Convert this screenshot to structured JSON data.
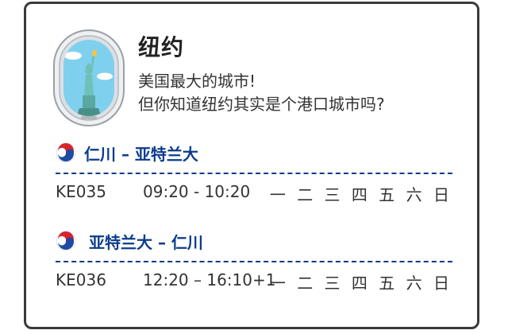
{
  "city": {
    "title": "纽约",
    "desc_line1": "美国最大的城市!",
    "desc_line2": "但你知道纽约其实是个港口城市吗?"
  },
  "routes": [
    {
      "name": "仁川 – 亚特兰大",
      "flight": "KE035",
      "time": "09:20 - 10:20",
      "days": "一 二 三 四 五 六 日"
    },
    {
      "name": "亚特兰大 – 仁川",
      "flight": "KE036",
      "time": "12:20 – 16:10+1",
      "days": "一 二 三 四 五 六 日"
    }
  ],
  "colors": {
    "accent": "#0b3c8c",
    "logo_red": "#d6242a",
    "logo_blue": "#1d4aa0",
    "sky": "#7fd0ef",
    "border": "#3a3a3a"
  },
  "icons": {
    "window": "airplane-window-statue-of-liberty-icon",
    "airline": "korean-air-logo-icon"
  }
}
